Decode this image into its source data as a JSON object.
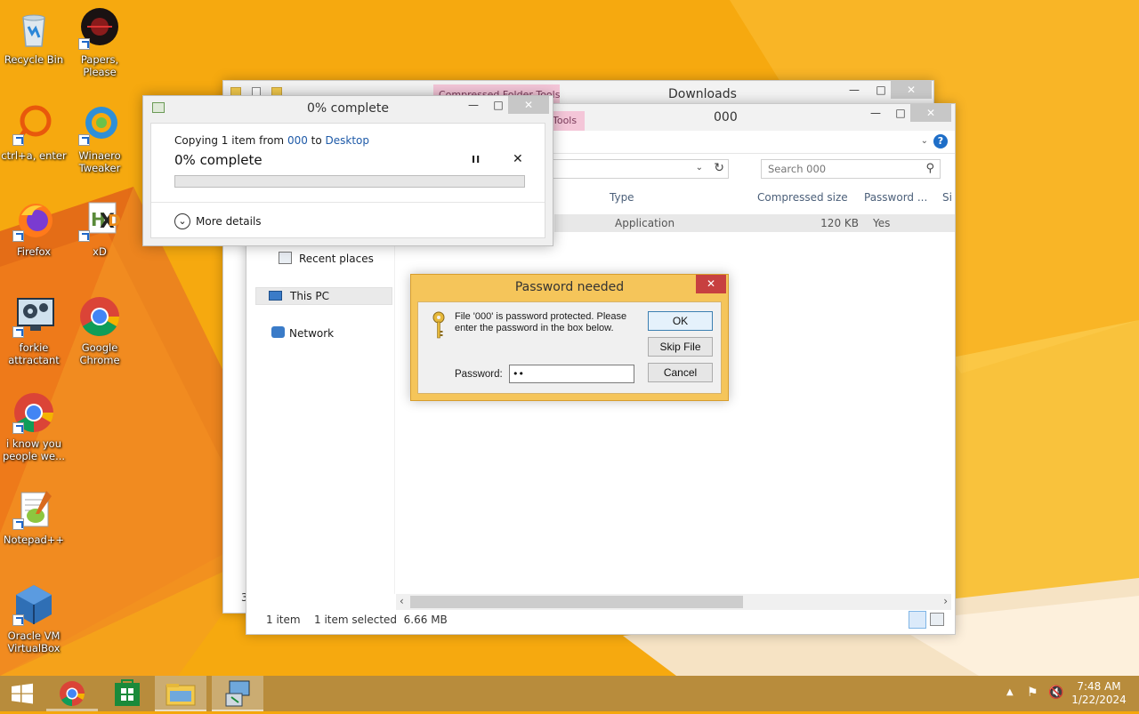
{
  "colors": {
    "accent": "#f5a70c",
    "taskbar": "#b88c3c",
    "dialog_frame": "#f5c55a",
    "close_red": "#c74040"
  },
  "desktop": {
    "icons": [
      {
        "label": "Recycle Bin",
        "icon": "recycle-bin-icon"
      },
      {
        "label": "Papers, Please",
        "icon": "papers-please-icon"
      },
      {
        "label": "ctrl+a, enter",
        "icon": "ring-app-icon"
      },
      {
        "label": "Winaero Tweaker",
        "icon": "winaero-tweaker-icon"
      },
      {
        "label": "Firefox",
        "icon": "firefox-icon"
      },
      {
        "label": "xD",
        "icon": "hxd-icon"
      },
      {
        "label": "forkie attractant",
        "icon": "gear-monitor-icon"
      },
      {
        "label": "Google Chrome",
        "icon": "chrome-icon"
      },
      {
        "label": "i know you people we...",
        "icon": "chrome-icon"
      },
      {
        "label": "Notepad++",
        "icon": "notepadpp-icon"
      },
      {
        "label": "Oracle VM VirtualBox",
        "icon": "virtualbox-icon"
      }
    ]
  },
  "downloads_window": {
    "title": "Downloads",
    "ribbon_tab": "Compressed Folder Tools",
    "status_left": "3"
  },
  "zip_window": {
    "title": "000",
    "ribbon_tab": "Tools",
    "search_placeholder": "Search 000",
    "columns": [
      "Type",
      "Compressed size",
      "Password ...",
      "Si"
    ],
    "row": {
      "type": "Application",
      "compressed_size": "120 KB",
      "password": "Yes"
    },
    "nav": [
      {
        "label": "Recent places",
        "icon": "recent-places-icon"
      },
      {
        "label": "This PC",
        "icon": "this-pc-icon"
      },
      {
        "label": "Network",
        "icon": "network-icon"
      }
    ],
    "status": {
      "items": "1 item",
      "selected": "1 item selected  6.66 MB"
    }
  },
  "copy_dialog": {
    "title": "0% complete",
    "copying_prefix": "Copying 1 item from ",
    "from": "000",
    "to_word": " to ",
    "to": "Desktop",
    "progress_text": "0% complete",
    "progress": 0,
    "more_details": "More details"
  },
  "password_dialog": {
    "title": "Password needed",
    "message": "File '000' is password protected.  Please enter the password in the box below.",
    "password_label": "Password:",
    "password_value": "••",
    "ok": "OK",
    "skip": "Skip File",
    "cancel": "Cancel"
  },
  "taskbar": {
    "time": "7:48 AM",
    "date": "1/22/2024"
  }
}
